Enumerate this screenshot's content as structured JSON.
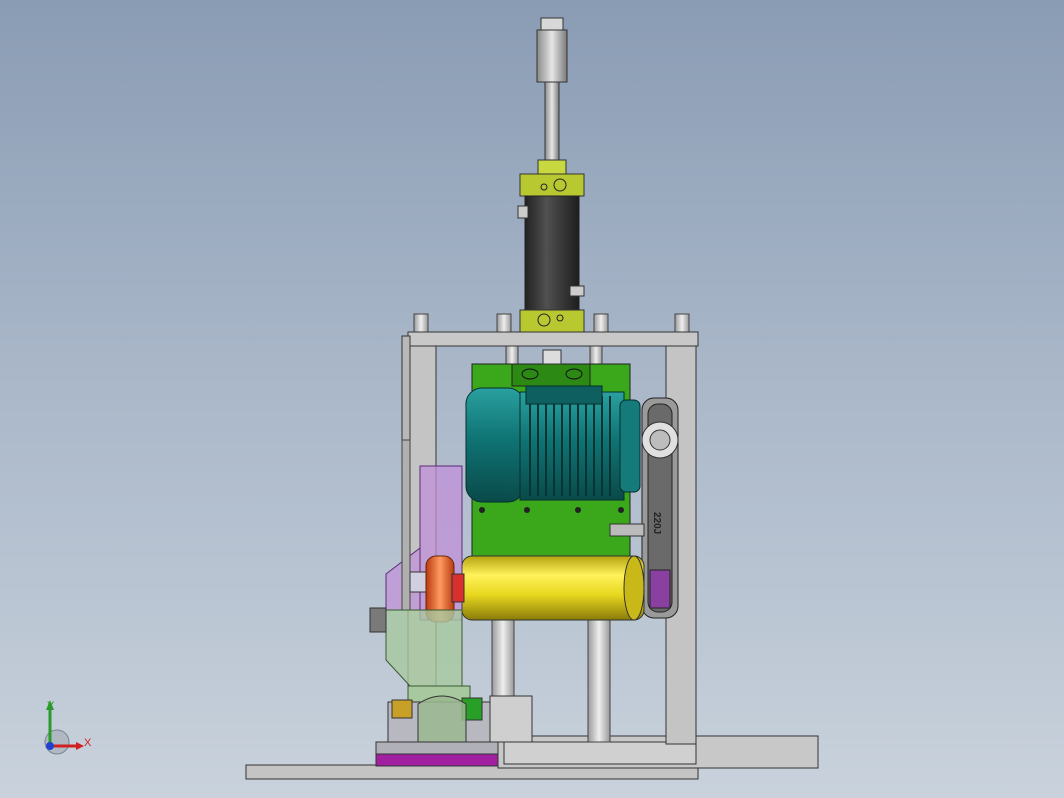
{
  "viewport": {
    "name": "cad-3d-viewport"
  },
  "belt": {
    "label": "220J"
  },
  "triad": {
    "x_label": "X",
    "y_label": "Y"
  },
  "colors": {
    "background_top": "#8a9cb4",
    "frame": "#c8c8c8",
    "motor": "#1a8a8a",
    "mount_plate": "#3aa81a",
    "drum": "#e8d820",
    "cylinder": "#3a3a3a",
    "cylinder_flange": "#b8c830",
    "side_guard": "#c090d8",
    "lower_bracket": "#a8c8a0",
    "base_plate": "#a020a0",
    "orange_nut": "#e86a30"
  }
}
